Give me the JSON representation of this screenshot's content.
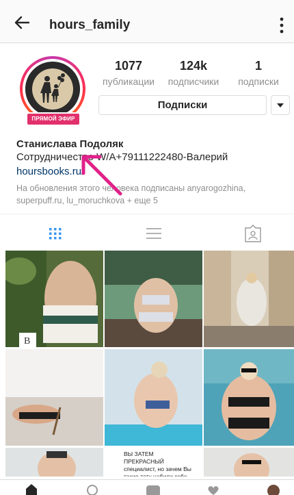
{
  "header": {
    "username": "hours_family",
    "back_icon": "arrow-left-icon",
    "more_icon": "more-vertical-icon"
  },
  "profile": {
    "live_badge": "ПРЯМОЙ ЭФИР",
    "stats": [
      {
        "count": "1077",
        "label": "публикации"
      },
      {
        "count": "124k",
        "label": "подписчики"
      },
      {
        "count": "1",
        "label": "подписки"
      }
    ],
    "follow_button": "Подписки",
    "name": "Станислава Подоляк",
    "bio": "Сотрудничество W/A+79111222480-Валерий",
    "website": "hoursbooks.ru/",
    "followed_by": "На обновления этого человека подписаны anyarogozhina, superpuff.ru, lu_moruchkova + еще 5"
  },
  "tabs": [
    {
      "name": "grid-view",
      "icon": "grid-icon",
      "active": true
    },
    {
      "name": "list-view",
      "icon": "list-icon",
      "active": false
    },
    {
      "name": "tagged",
      "icon": "tagged-person-icon",
      "active": false
    }
  ],
  "grid_post_text": "ВЫ ЗАТЕМ ПРЕКРАСНЫЙ специалист, но зачем Вы такие тату набили себе на руки? Почему такой ярко-рыжий цвет волос? Почему в",
  "colors": {
    "accent_live": "#e1306c",
    "link": "#003569",
    "muted": "#8e8e8e",
    "active_tab": "#3897f0",
    "arrow": "#e0218a"
  }
}
